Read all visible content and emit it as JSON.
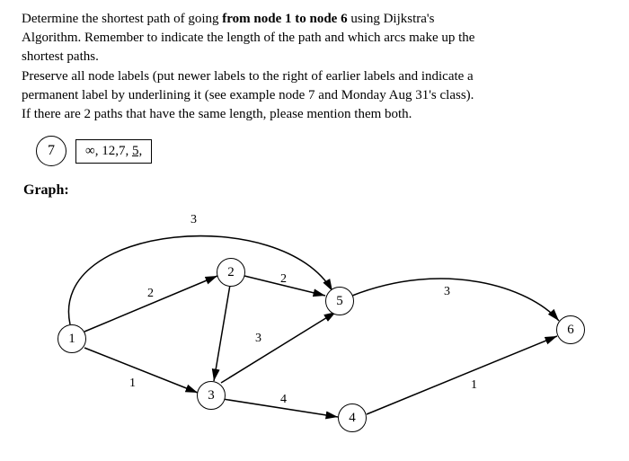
{
  "problem": {
    "line1_pre": "Determine the shortest path of going ",
    "line1_bold": "from node 1 to node 6",
    "line1_post": " using Dijkstra's",
    "line2": "Algorithm. Remember to indicate the length of the path and which arcs make up the",
    "line3": "shortest paths.",
    "line4": "Preserve all node labels (put newer labels to the right of earlier labels and indicate a",
    "line5": "permanent label by underlining it (see example node 7 and Monday Aug 31's class).",
    "line6": "If there are 2 paths that have the same length, please mention them both."
  },
  "example": {
    "node_label": "7",
    "box_a": "∞, 12,7, ",
    "box_b_underlined": "5,"
  },
  "graph_title": "Graph:",
  "graph": {
    "nodes": {
      "n1": "1",
      "n2": "2",
      "n3": "3",
      "n4": "4",
      "n5": "5",
      "n6": "6"
    },
    "edge_weights": {
      "e1_5_top": "3",
      "e1_2": "2",
      "e2_5": "2",
      "e2_3": "3",
      "e5_6": "3",
      "e1_3": "1",
      "e3_4": "4",
      "e4_6": "1"
    }
  }
}
